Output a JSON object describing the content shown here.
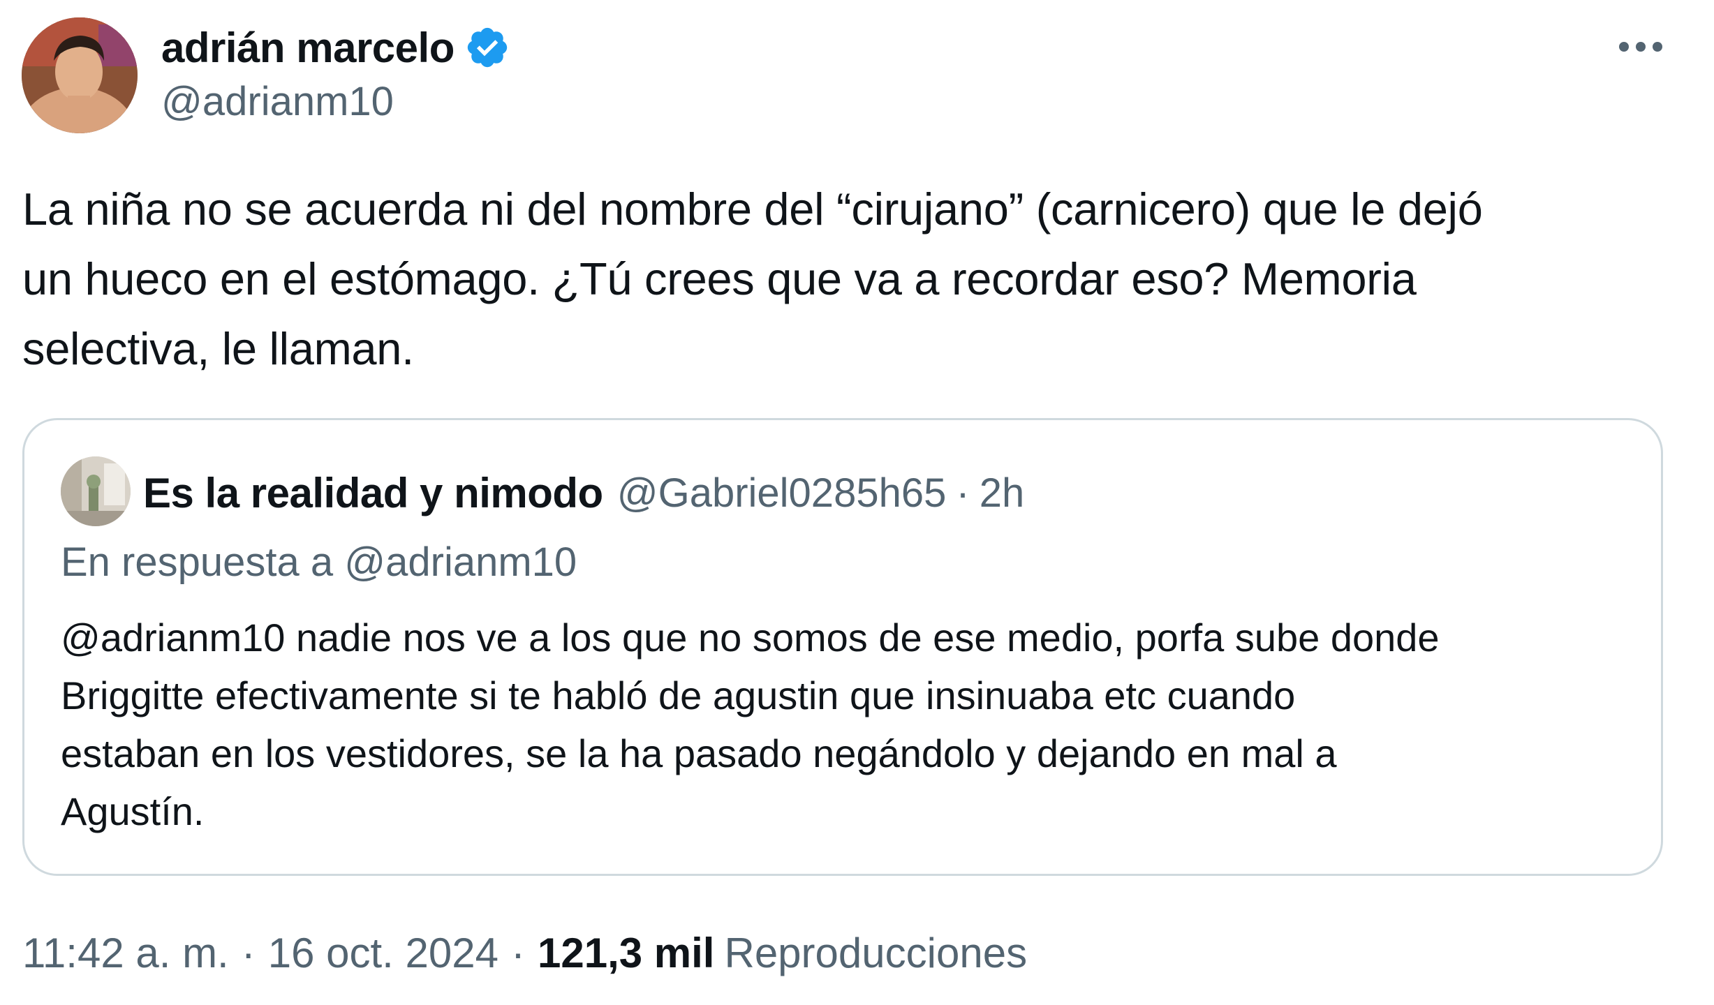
{
  "author": {
    "display_name": "adrián marcelo",
    "handle": "@adrianm10",
    "verified": true,
    "avatar_icon": "profile-photo-avatar"
  },
  "more_icon": "more-horizontal-icon",
  "tweet": {
    "text_lines": [
      "La niña no se acuerda ni del nombre del “cirujano” (carnicero) que le dejó",
      "un hueco en el estómago. ¿Tú crees que va a recordar eso? Memoria",
      "selectiva, le llaman."
    ]
  },
  "quote": {
    "display_name": "Es la realidad y nimodo",
    "handle": "@Gabriel0285h65",
    "separator": "·",
    "time": "2h",
    "reply_to": "En respuesta a @adrianm10",
    "text_lines": [
      "@adrianm10 nadie nos ve a los que no somos de ese medio, porfa sube donde",
      "Briggitte efectivamente si te habló de agustin que insinuaba etc cuando",
      "estaban en los vestidores, se la ha pasado negándolo y dejando en mal a",
      "Agustín."
    ]
  },
  "meta": {
    "time": "11:42 a. m.",
    "separator": "·",
    "date": "16 oct. 2024",
    "views_count": "121,3 mil",
    "views_label": "Reproducciones"
  },
  "colors": {
    "text_primary": "#0f1419",
    "text_secondary": "#536471",
    "verified_blue": "#1d9bf0",
    "border": "#cfd9de"
  }
}
